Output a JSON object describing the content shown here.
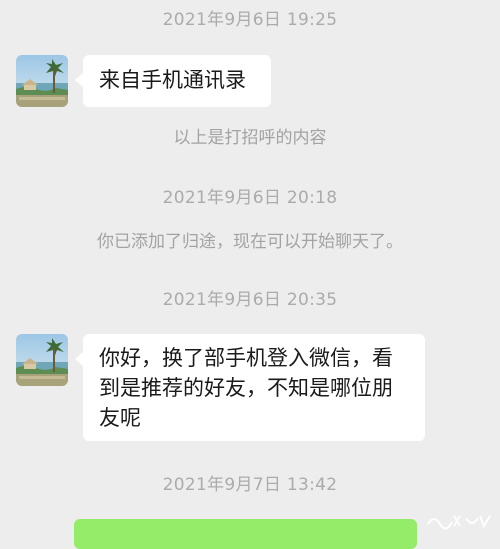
{
  "chat": {
    "timestamps": [
      "2021年9月6日 19:25",
      "2021年9月6日 20:18",
      "2021年9月6日 20:35",
      "2021年9月7日 13:42"
    ],
    "system_messages": [
      "以上是打招呼的内容",
      "你已添加了归途，现在可以开始聊天了。"
    ],
    "messages": [
      {
        "sender": "other",
        "text": "来自手机通讯录"
      },
      {
        "sender": "other",
        "text": "你好，换了部手机登入微信，看到是推荐的好友，不知是哪位朋友呢"
      }
    ],
    "colors": {
      "background": "#ededed",
      "incoming_bubble": "#ffffff",
      "outgoing_bubble": "#95ec69",
      "timestamp_text": "#ababab"
    },
    "avatar_icon": "contact-avatar-icon"
  }
}
